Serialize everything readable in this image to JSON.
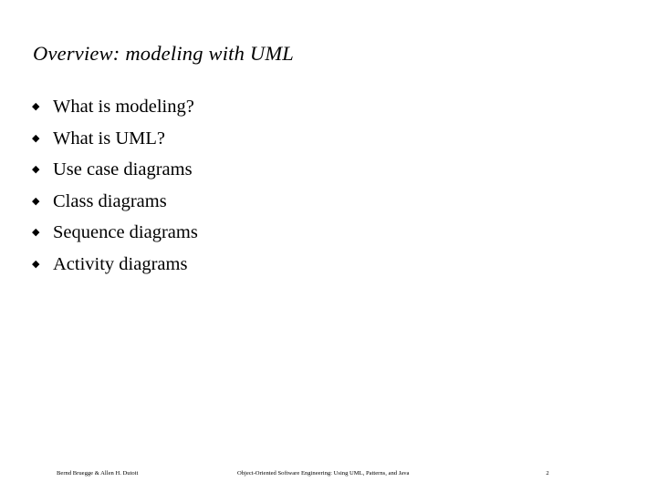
{
  "slide": {
    "title": "Overview: modeling with UML",
    "bullet_marker_glyph": "◆",
    "bullets": [
      {
        "label": "What is modeling?"
      },
      {
        "label": "What is UML?"
      },
      {
        "label": "Use case diagrams"
      },
      {
        "label": "Class diagrams"
      },
      {
        "label": "Sequence diagrams"
      },
      {
        "label": "Activity diagrams"
      }
    ],
    "footer": {
      "authors": "Bernd Bruegge & Allen H. Dutoit",
      "book_title": "Object-Oriented Software Engineering: Using UML, Patterns, and Java",
      "page_number": "2"
    },
    "colors": {
      "background": "#ffffff",
      "text": "#000000"
    }
  }
}
